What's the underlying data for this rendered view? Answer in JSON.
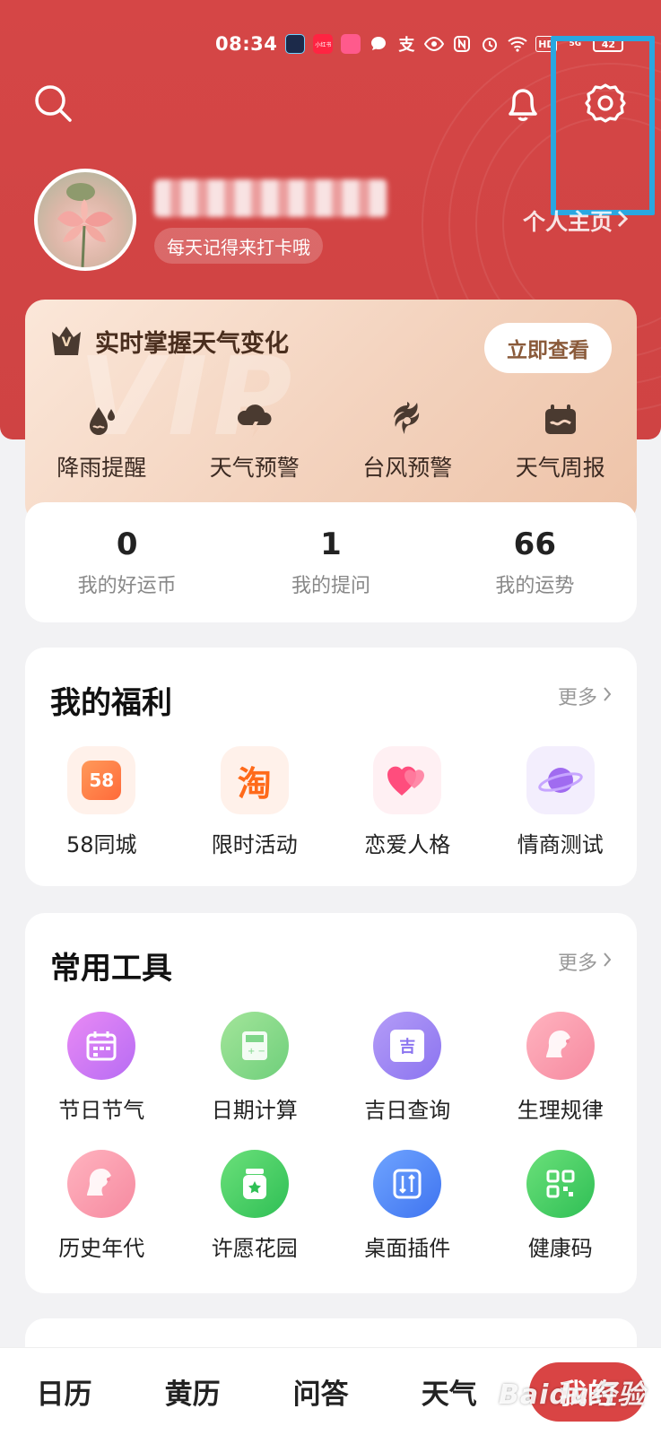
{
  "status_bar": {
    "time": "08:34",
    "battery": "42",
    "icons": [
      "app-icon",
      "xiaohongshu-icon",
      "swan-icon",
      "message-icon",
      "alipay-icon",
      "eye-icon",
      "nfc-icon",
      "alarm-icon",
      "wifi-icon",
      "hd-icon",
      "5g-signal-icon",
      "battery-icon"
    ],
    "badge_xhs": "小红书",
    "hd": "HD",
    "signal": "5G"
  },
  "header": {
    "signature": "每天记得来打卡哦",
    "profile_link": "个人主页",
    "accent_color": "#d54646"
  },
  "vip": {
    "title": "实时掌握天气变化",
    "button": "立即查看",
    "badge": "V",
    "watermark": "VIP",
    "features": [
      {
        "label": "降雨提醒",
        "icon": "rain-drop-icon"
      },
      {
        "label": "天气预警",
        "icon": "storm-cloud-icon"
      },
      {
        "label": "台风预警",
        "icon": "typhoon-icon"
      },
      {
        "label": "天气周报",
        "icon": "calendar-report-icon"
      }
    ]
  },
  "stats": [
    {
      "value": "0",
      "label": "我的好运币"
    },
    {
      "value": "1",
      "label": "我的提问"
    },
    {
      "value": "66",
      "label": "我的运势"
    }
  ],
  "welfare": {
    "title": "我的福利",
    "more": "更多",
    "items": [
      {
        "label": "58同城",
        "icon": "58-tongcheng-icon",
        "glyph": "58"
      },
      {
        "label": "限时活动",
        "icon": "taobao-icon",
        "glyph": "淘"
      },
      {
        "label": "恋爱人格",
        "icon": "hearts-icon"
      },
      {
        "label": "情商测试",
        "icon": "planet-icon"
      }
    ]
  },
  "tools": {
    "title": "常用工具",
    "more": "更多",
    "row1": [
      {
        "label": "节日节气",
        "icon": "calendar-icon"
      },
      {
        "label": "日期计算",
        "icon": "calculator-icon"
      },
      {
        "label": "吉日查询",
        "icon": "lucky-day-icon",
        "glyph": "吉"
      },
      {
        "label": "生理规律",
        "icon": "woman-profile-icon"
      }
    ],
    "row2": [
      {
        "label": "历史年代",
        "icon": "woman-profile-icon"
      },
      {
        "label": "许愿花园",
        "icon": "wish-jar-icon"
      },
      {
        "label": "桌面插件",
        "icon": "widget-icon"
      },
      {
        "label": "健康码",
        "icon": "qr-code-icon"
      }
    ]
  },
  "bottom_nav": [
    {
      "label": "日历"
    },
    {
      "label": "黄历"
    },
    {
      "label": "问答"
    },
    {
      "label": "天气"
    },
    {
      "label": "我的"
    }
  ],
  "watermark": "Baidu经验"
}
